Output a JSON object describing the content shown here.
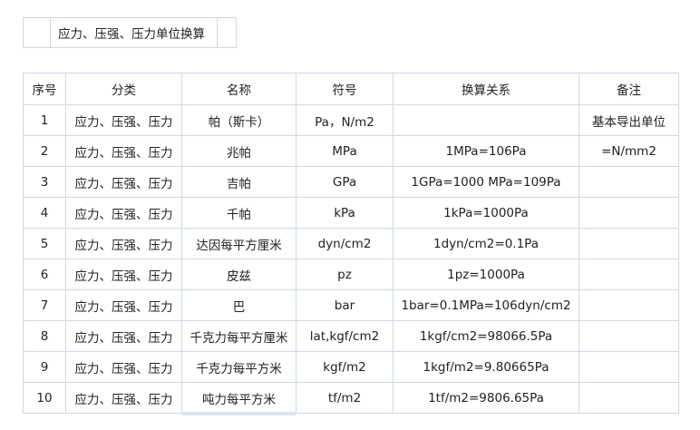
{
  "title": "应力、压强、压力单位换算",
  "table": {
    "headers": [
      "序号",
      "分类",
      "名称",
      "符号",
      "换算关系",
      "备注"
    ],
    "rows": [
      [
        "1",
        "应力、压强、压力",
        "帕（斯卡）",
        "Pa，N/m2",
        "",
        "基本导出单位"
      ],
      [
        "2",
        "应力、压强、压力",
        "兆帕",
        "MPa",
        "1MPa=106Pa",
        "=N/mm2"
      ],
      [
        "3",
        "应力、压强、压力",
        "吉帕",
        "GPa",
        "1GPa=1000 MPa=109Pa",
        ""
      ],
      [
        "4",
        "应力、压强、压力",
        "千帕",
        "kPa",
        "1kPa=1000Pa",
        ""
      ],
      [
        "5",
        "应力、压强、压力",
        "达因每平方厘米",
        "dyn/cm2",
        "1dyn/cm2=0.1Pa",
        ""
      ],
      [
        "6",
        "应力、压强、压力",
        "皮兹",
        "pz",
        "1pz=1000Pa",
        ""
      ],
      [
        "7",
        "应力、压强、压力",
        "巴",
        "bar",
        "1bar=0.1MPa=106dyn/cm2",
        ""
      ],
      [
        "8",
        "应力、压强、压力",
        "千克力每平方厘米",
        "lat,kgf/cm2",
        "1kgf/cm2=98066.5Pa",
        ""
      ],
      [
        "9",
        "应力、压强、压力",
        "千克力每平方米",
        "kgf/m2",
        "1kgf/m2=9.80665Pa",
        ""
      ],
      [
        "10",
        "应力、压强、压力",
        "吨力每平方米",
        "tf/m2",
        "1tf/m2=9806.65Pa",
        ""
      ]
    ]
  }
}
